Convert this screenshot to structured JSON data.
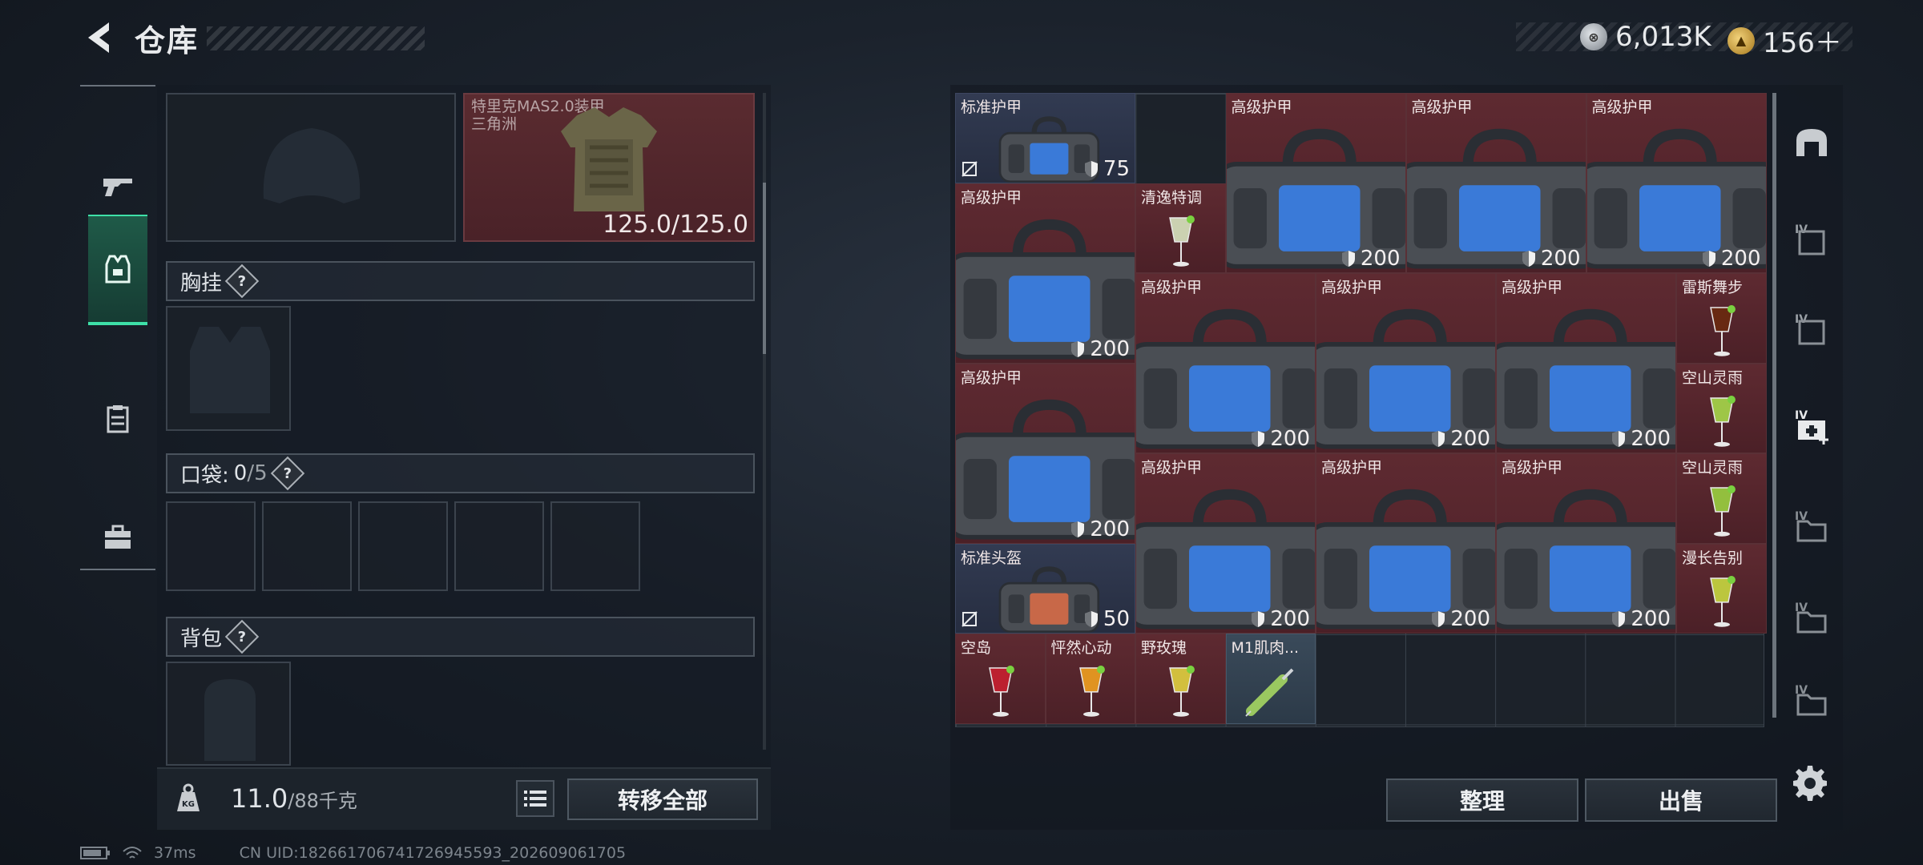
{
  "header": {
    "title": "仓库"
  },
  "currency": {
    "silver": "6,013K",
    "gold": "156＋"
  },
  "left_tabs": [
    {
      "name": "weapon-tab",
      "icon": "gun-icon"
    },
    {
      "name": "gear-tab",
      "icon": "vest-icon",
      "active": true
    },
    {
      "name": "bag-tab",
      "icon": "clipboard-icon"
    },
    {
      "name": "case-tab",
      "icon": "briefcase-icon"
    }
  ],
  "equipment": {
    "armor_name": "特里克MAS2.0装甲",
    "armor_sub": "三角洲",
    "armor_durability": "125.0/125.0",
    "chest_label": "胸挂",
    "pocket_label": "口袋:",
    "pocket_count": "0",
    "pocket_max": "/5",
    "backpack_label": "背包",
    "help": "?"
  },
  "bottom_left": {
    "weight": "11.0",
    "weight_max": "/88千克",
    "transfer_all": "转移全部",
    "kg": "KG"
  },
  "bottom_right": {
    "sort": "整理",
    "sell": "出售"
  },
  "items": [
    {
      "label": "标准护甲",
      "dur": "75",
      "type": "bag",
      "color": "blue"
    },
    {
      "label": "高级护甲",
      "dur": "200",
      "type": "bag"
    },
    {
      "label": "高级护甲",
      "dur": "200",
      "type": "bag"
    },
    {
      "label": "高级护甲",
      "dur": "200",
      "type": "bag"
    },
    {
      "label": "高级护甲",
      "dur": "200",
      "type": "bag"
    },
    {
      "label": "清逸特调",
      "type": "drink"
    },
    {
      "label": "高级护甲",
      "dur": "200",
      "type": "bag"
    },
    {
      "label": "高级护甲",
      "dur": "200",
      "type": "bag"
    },
    {
      "label": "高级护甲",
      "dur": "200",
      "type": "bag"
    },
    {
      "label": "雷斯舞步",
      "type": "drink"
    },
    {
      "label": "高级护甲",
      "dur": "200",
      "type": "bag"
    },
    {
      "label": "空山灵雨",
      "type": "drink"
    },
    {
      "label": "高级护甲",
      "dur": "200",
      "type": "bag"
    },
    {
      "label": "高级护甲",
      "dur": "200",
      "type": "bag"
    },
    {
      "label": "高级护甲",
      "dur": "200",
      "type": "bag"
    },
    {
      "label": "空山灵雨",
      "type": "drink"
    },
    {
      "label": "标准头盔",
      "dur": "50",
      "type": "helmet",
      "color": "blue"
    },
    {
      "label": "漫长告别",
      "type": "drink"
    },
    {
      "label": "空岛",
      "type": "drink"
    },
    {
      "label": "怦然心动",
      "type": "drink"
    },
    {
      "label": "野玫瑰",
      "type": "drink"
    },
    {
      "label": "M1肌肉...",
      "type": "syringe",
      "color": "teal"
    }
  ],
  "footer": {
    "ping": "37ms",
    "uid": "CN UID:1826617067417269455​93_202609061705"
  },
  "colors": {
    "accent": "#3ee0a8",
    "item_red": "#5e2a31",
    "item_blue": "#323b52"
  }
}
